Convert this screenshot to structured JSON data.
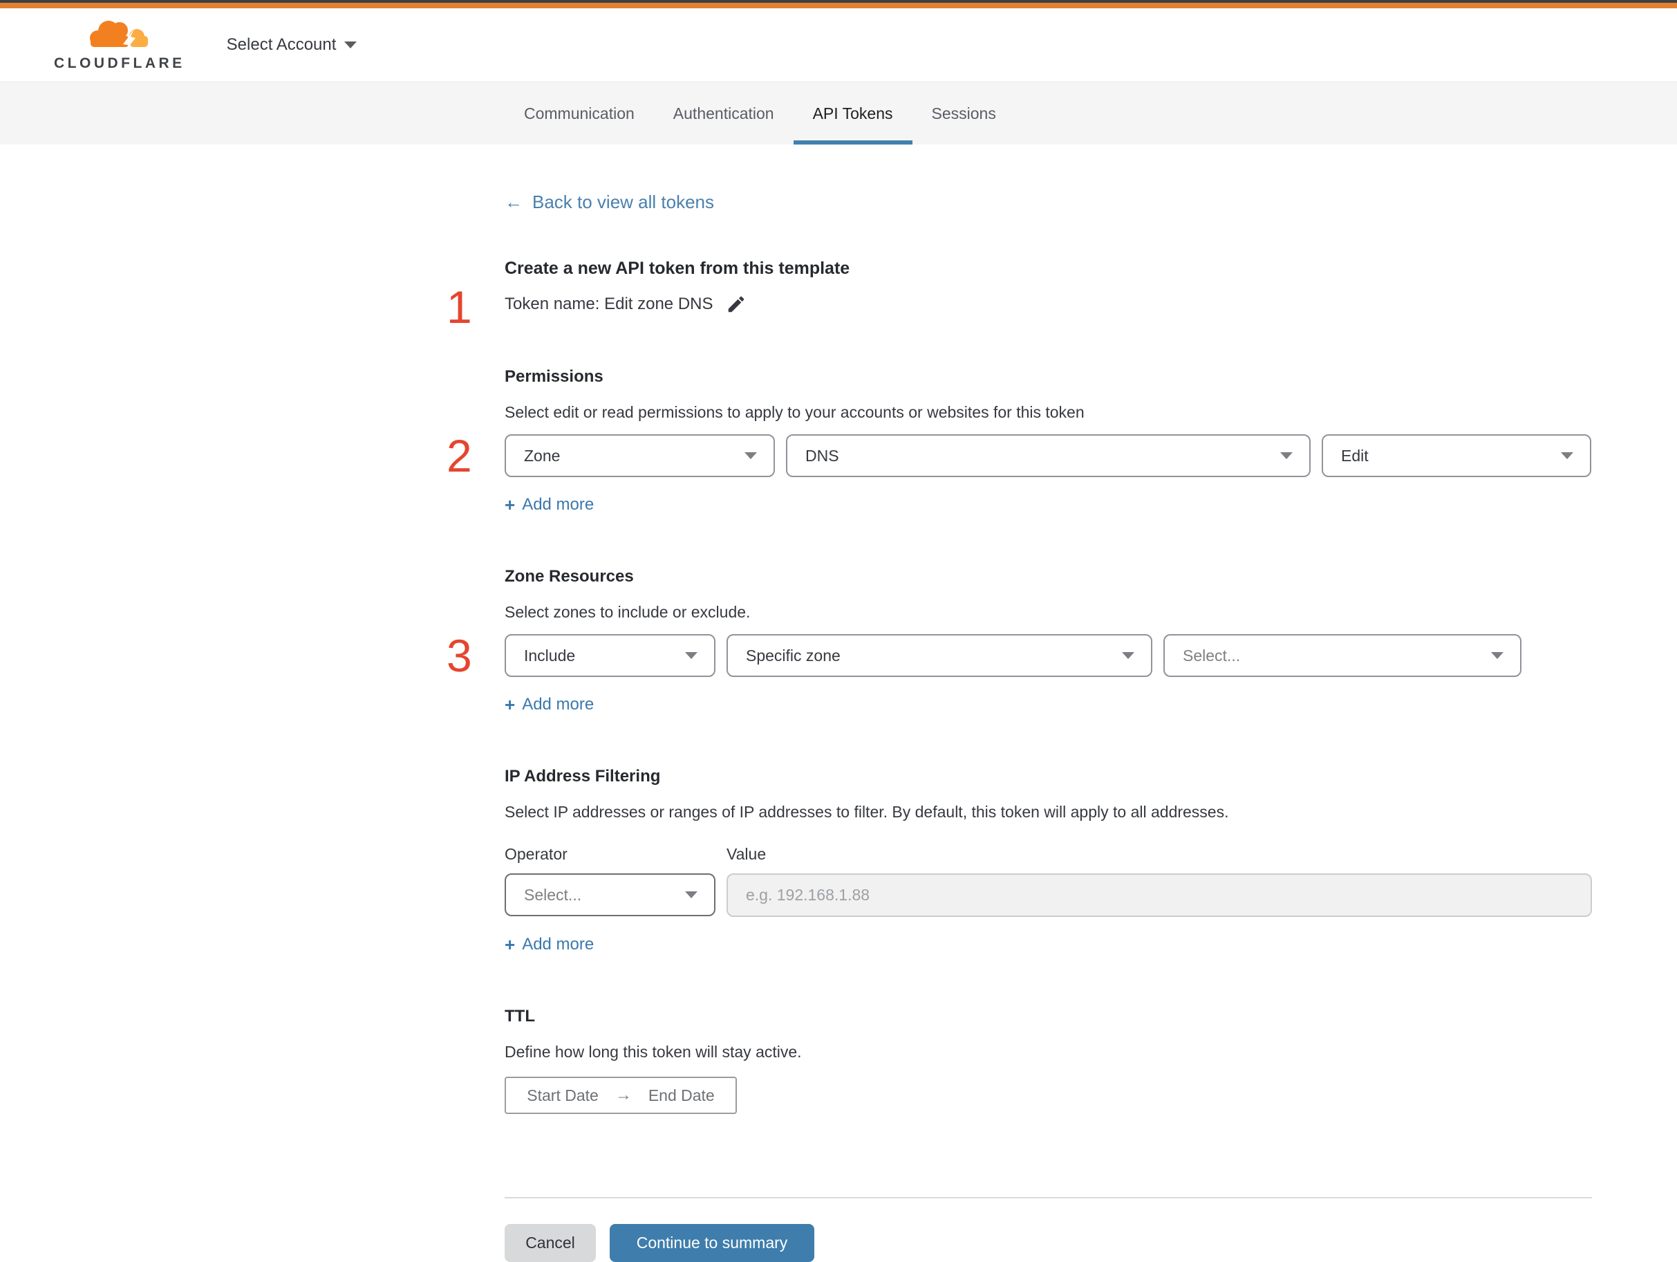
{
  "header": {
    "logo_text": "CLOUDFLARE",
    "account_selector": "Select Account"
  },
  "tabs": [
    {
      "label": "Communication"
    },
    {
      "label": "Authentication"
    },
    {
      "label": "API Tokens"
    },
    {
      "label": "Sessions"
    }
  ],
  "back": {
    "arrow": "←",
    "label": "Back to view all tokens"
  },
  "template": {
    "step_number": "1",
    "heading": "Create a new API token from this template",
    "token_name": "Token name: Edit zone DNS"
  },
  "permissions": {
    "step_number": "2",
    "heading": "Permissions",
    "description": "Select edit or read permissions to apply to your accounts or websites for this token",
    "dropdowns": [
      {
        "value": "Zone"
      },
      {
        "value": "DNS"
      },
      {
        "value": "Edit"
      }
    ],
    "add_more_plus": "+",
    "add_more_label": "Add more"
  },
  "zone_resources": {
    "step_number": "3",
    "heading": "Zone Resources",
    "description": "Select zones to include or exclude.",
    "dropdowns": [
      {
        "value": "Include"
      },
      {
        "value": "Specific zone"
      },
      {
        "value": "Select..."
      }
    ],
    "add_more_plus": "+",
    "add_more_label": "Add more"
  },
  "ip_filtering": {
    "heading": "IP Address Filtering",
    "description": "Select IP addresses or ranges of IP addresses to filter. By default, this token will apply to all addresses.",
    "operator_label": "Operator",
    "value_label": "Value",
    "operator_placeholder": "Select...",
    "value_placeholder": "e.g. 192.168.1.88",
    "add_more_plus": "+",
    "add_more_label": "Add more"
  },
  "ttl": {
    "heading": "TTL",
    "description": "Define how long this token will stay active.",
    "start_date": "Start Date",
    "arrow": "→",
    "end_date": "End Date"
  },
  "footer": {
    "cancel_label": "Cancel",
    "continue_label": "Continue to summary"
  },
  "colors": {
    "brand_bar_orange": "#e08232",
    "logo_orange": "#f38020",
    "logo_light_orange": "#fbad41",
    "accent_blue": "#3e7dac",
    "link_blue": "#3a78ae",
    "step_number_red": "#e5452f",
    "tabbar_gray": "#f5f5f6"
  }
}
